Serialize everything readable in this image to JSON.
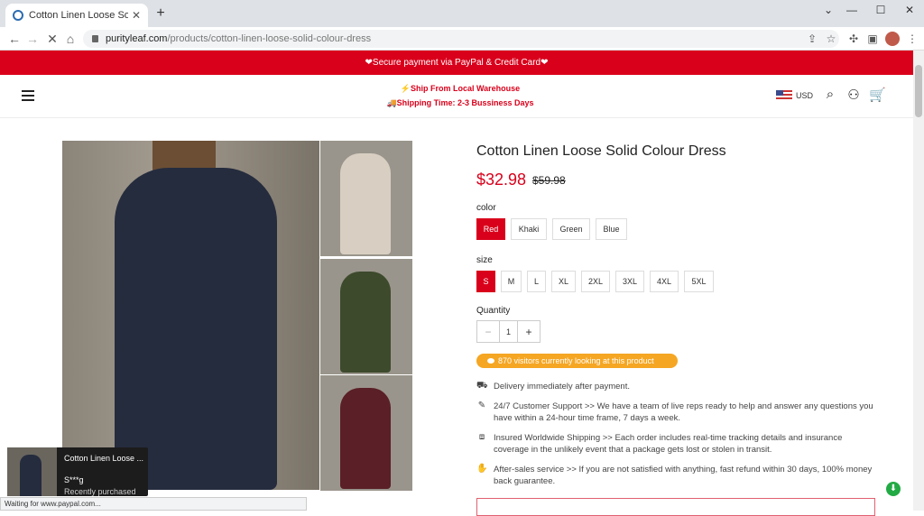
{
  "browser": {
    "tab_title": "Cotton Linen Loose Solid Colour Dress",
    "tab_close": "✕",
    "new_tab": "+",
    "url_domain": "purityleaf.com",
    "url_path": "/products/cotton-linen-loose-solid-colour-dress",
    "status_text": "Waiting for www.paypal.com...",
    "icons": {
      "back": "arrow-left-icon",
      "forward": "arrow-right-icon",
      "stop": "close-icon",
      "home": "home-icon",
      "share": "share-icon",
      "bookmark": "star-icon",
      "extensions": "puzzle-icon",
      "sidepanel": "sidepanel-icon",
      "menu": "kebab-menu-icon"
    }
  },
  "promo_bar": {
    "text": "❤Secure payment via PayPal & Credit Card❤"
  },
  "header": {
    "ship_line1": "⚡Ship From Local Warehouse",
    "ship_line2": "🚚Shipping Time: 2-3 Bussiness Days",
    "currency": "USD"
  },
  "product": {
    "title": "Cotton Linen Loose Solid Colour Dress",
    "price": "$32.98",
    "compare_price": "$59.98",
    "color_label": "color",
    "colors": [
      "Red",
      "Khaki",
      "Green",
      "Blue"
    ],
    "selected_color": "Red",
    "size_label": "size",
    "sizes": [
      "S",
      "M",
      "L",
      "XL",
      "2XL",
      "3XL",
      "4XL",
      "5XL"
    ],
    "selected_size": "S",
    "quantity_label": "Quantity",
    "quantity": "1",
    "qty_minus": "−",
    "qty_plus": "+",
    "visitors_text": "870 visitors currently looking at this product",
    "features": [
      "Delivery immediately after payment.",
      "24/7 Customer Support >> We have a team of live reps ready to help and answer any questions you have within a 24-hour time frame, 7 days a week.",
      "Insured Worldwide Shipping >> Each order includes real-time tracking details and insurance coverage in the unlikely event that a package gets lost or stolen in transit.",
      "After-sales service >> If you are not satisfied with anything, fast refund within 30 days, 100% money back guarantee."
    ]
  },
  "popup": {
    "title": "Cotton Linen Loose ...",
    "name": "S***g",
    "status": "Recently purchased"
  },
  "colors": {
    "brand_red": "#d9001b",
    "visitor_orange": "#f5a623",
    "thumb_khaki": "#d8cfc2",
    "thumb_green": "#3d4a2c",
    "thumb_wine": "#5a1f27"
  }
}
